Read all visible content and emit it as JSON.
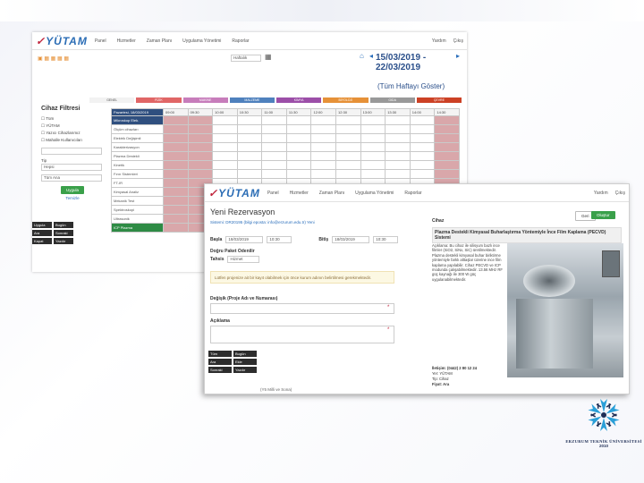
{
  "back_window": {
    "logo": {
      "main": "YÜTAM",
      "mark": "✓"
    },
    "nav": [
      "Panel",
      "Hizmetler",
      "Zaman Planı",
      "Uygulama Yönetimi",
      "Raporlar"
    ],
    "user_menu": [
      "Yardım",
      "Çıkış"
    ],
    "view_select": "Haftalık",
    "date_range": "15/03/2019 - 22/03/2019",
    "show_all_link": "(Tüm Haftayı Göster)",
    "category_tabs": [
      {
        "label": "GENEL",
        "color": "#f2f2f2"
      },
      {
        "label": "FİZİK",
        "color": "#e06666"
      },
      {
        "label": "MAKİNE",
        "color": "#c77dbb"
      },
      {
        "label": "MALZEME",
        "color": "#4f81bd"
      },
      {
        "label": "KİMYA",
        "color": "#9c4fa8"
      },
      {
        "label": "BİYOLOJİ",
        "color": "#e69138"
      },
      {
        "label": "GIDA",
        "color": "#999999"
      },
      {
        "label": "ÇEVRE",
        "color": "#cc4125"
      }
    ],
    "filter": {
      "title": "Cihaz Filtresi",
      "options": [
        "Tüm",
        "YÜTAM",
        "Yazıcı Cihazlarımız",
        "Mahalle Kullanıcıları"
      ],
      "search_placeholder": "",
      "kind_label": "Tip",
      "kind_value": "Hepsi",
      "owner_value": "Tüm Ana",
      "apply_button": "Uygula",
      "toggle_link": "Temizle"
    },
    "dark_buttons": [
      "Uygula",
      "Bugün",
      "Ara",
      "Sonraki",
      "Kapat",
      "Yazdır"
    ],
    "schedule": {
      "date_header": "Pazartesi, 18/03/2019",
      "times": [
        "09:00",
        "09:30",
        "10:00",
        "10:30",
        "11:00",
        "11:30",
        "12:00",
        "12:30",
        "13:00",
        "13:30",
        "14:00",
        "14:30"
      ],
      "rows": [
        "Mikroskop Elek.",
        "Ölçüm cihazları",
        "Elektrik Değişimli",
        "Karakterizasyon",
        "Plazma Destekli",
        "Kinetik",
        "Fırın Sistemleri",
        "FT-IR",
        "Kimyasal Analiz",
        "Mekanik Test",
        "Spektroskopi",
        "Ultrasonik"
      ],
      "selected_row": "ICP Plazma"
    }
  },
  "front_window": {
    "logo": "YÜTAM",
    "nav": [
      "Panel",
      "Hizmetler",
      "Zaman Planı",
      "Uygulama Yönetimi",
      "Raporlar"
    ],
    "user_menu": [
      "Yardım",
      "Çıkış"
    ],
    "title": "Yeni Rezervasyon",
    "subtitle": "Sistemi: DR20195 (bilgi eposta: info@erzurum.edu.tr) Yeni",
    "start_label": "Başla",
    "start_date": "18/03/2019",
    "start_time": "10:30",
    "end_label": "Bitiş",
    "end_date": "18/03/2019",
    "end_time": "10:30",
    "slots_label": "Doğru Paket Odenilir",
    "payment_label": "Tahsis",
    "payment_value": "Hizmet",
    "alert": "Lütfen projenize ait bir kayıt olabilmek için önce kurum adının belirtilmesi gerekmektedir.",
    "project_label": "Değişik (Proje Adı ve Numarası)",
    "notes_label": "Açıklama",
    "back_button": "Geri",
    "save_button": "Oluştur",
    "device_section": "Cihaz",
    "device_title": "Plazma Destekli Kimyasal Buharlaştırma Yöntemiyle İnce Film Kaplama (PECVD) Sistemi",
    "device_desc": "Açıklama: Bu cihaz ile silisyum bazlı ince filmler (SiO2, SiNx, SiC) üretilmektedir. Plazma destekli kimyasal buhar biriktirme yöntemiyle farklı alttaşlar üzerine ince film kaplama yapılabilir. Cihaz PECVD ve ICP modunda çalışabilmektedir. 13.56 MHz RF güç kaynağı ile 300 W güç uygulanabilmektedir.",
    "device_contact": "İletişim: (0442) 2 80 12 24",
    "device_unit": "Yer: YÜTAM",
    "device_code": "Tip: Cihaz",
    "device_price": "Fiyat: Ara",
    "footer_link": "(Y5 Milli ve Sona)",
    "dark_buttons": [
      "Tüm",
      "Bugün",
      "Ara",
      "Ekle",
      "Sonraki",
      "Yazdır"
    ]
  },
  "brand": {
    "name": "ERZURUM TEKNİK ÜNİVERSİTESİ",
    "year": "2010"
  }
}
